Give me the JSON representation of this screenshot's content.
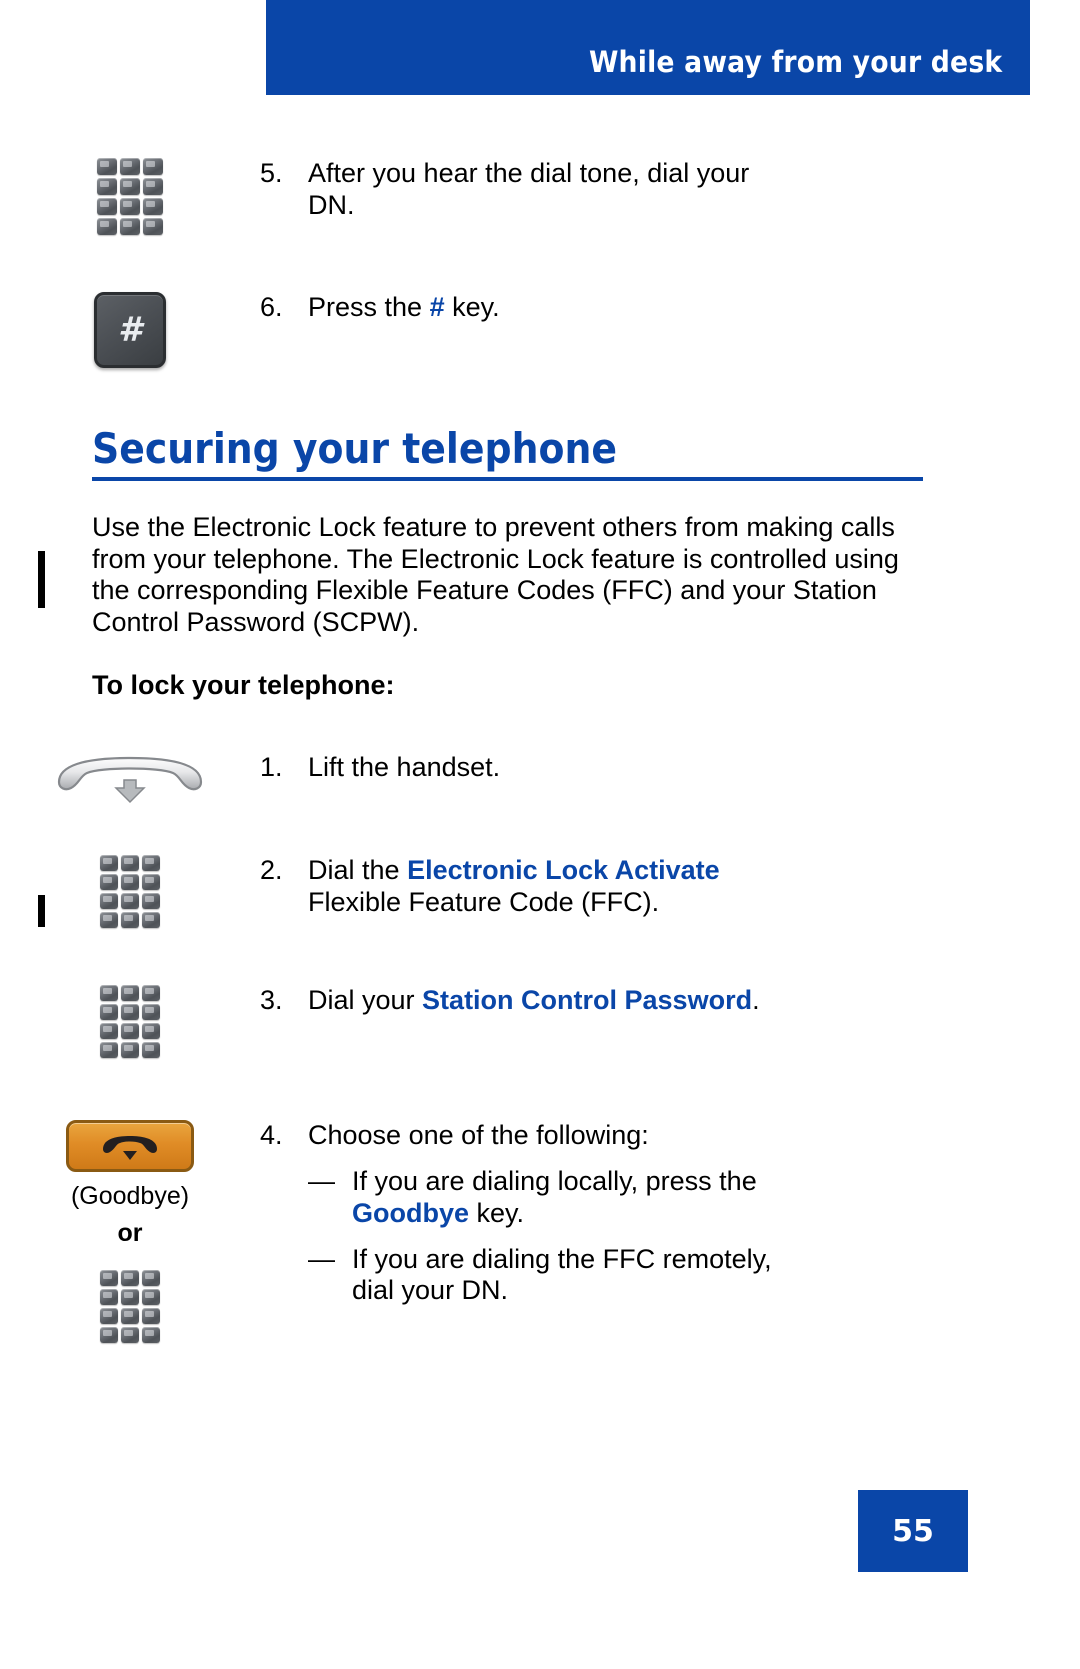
{
  "header": {
    "running_title": "While away from your desk",
    "banner_color": "#0a46a8"
  },
  "steps_top": [
    {
      "number": "5.",
      "line1": "After you hear the dial tone, dial your",
      "line2": "DN.",
      "icon": "keypad-icon"
    },
    {
      "number": "6.",
      "prefix": "Press the ",
      "emphasis": "#",
      "suffix": " key.",
      "icon": "hash-key-icon"
    }
  ],
  "section": {
    "heading": "Securing your telephone",
    "heading_color": "#0a46a8",
    "paragraph": "Use the Electronic Lock feature to prevent others from making calls from your telephone. The Electronic Lock feature is controlled using the corresponding Flexible Feature Codes (FFC) and your Station Control Password (SCPW).",
    "subheading": "To lock your telephone:"
  },
  "procedure": [
    {
      "number": "1.",
      "text": "Lift the handset.",
      "icon": "handset-icon"
    },
    {
      "number": "2.",
      "prefix": "Dial the ",
      "emphasis": "Electronic Lock Activate",
      "line2": "Flexible Feature Code (FFC).",
      "icon": "keypad-icon"
    },
    {
      "number": "3.",
      "prefix": "Dial your ",
      "emphasis": "Station Control Password",
      "suffix": ".",
      "icon": "keypad-icon"
    },
    {
      "number": "4.",
      "text": "Choose one of the following:",
      "icon": "goodbye-key-icon",
      "icon_label": "(Goodbye)",
      "icon_or": "or",
      "icon_second": "keypad-icon",
      "bullets": [
        {
          "mark": "—",
          "prefix": "If you are dialing locally, press the",
          "emphasis": "Goodbye",
          "suffix": " key."
        },
        {
          "mark": "—",
          "line1": "If you are dialing the FFC remotely,",
          "line2": "dial your DN."
        }
      ]
    }
  ],
  "footer": {
    "page_number": "55",
    "page_box_color": "#0a46a8"
  }
}
